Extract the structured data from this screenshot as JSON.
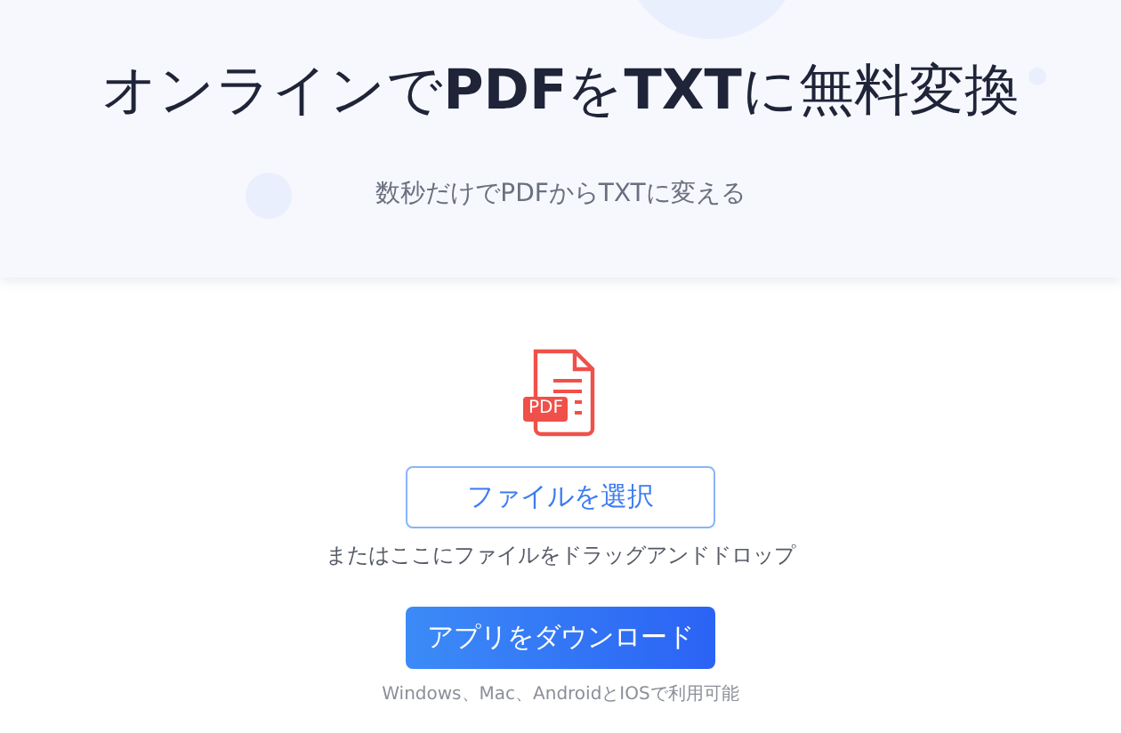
{
  "hero": {
    "title": "オンラインで**PDF**を**TXT**に無料変換",
    "subtitle": "数秒だけでPDFからTXTに変える"
  },
  "upload": {
    "select_button": "ファイルを選択",
    "drop_hint": "またはここにファイルをドラッグアンドドロップ",
    "file_badge": "PDF"
  },
  "download": {
    "button": "アプリをダウンロード",
    "note": "Windows、Mac、AndroidとIOSで利用可能"
  }
}
